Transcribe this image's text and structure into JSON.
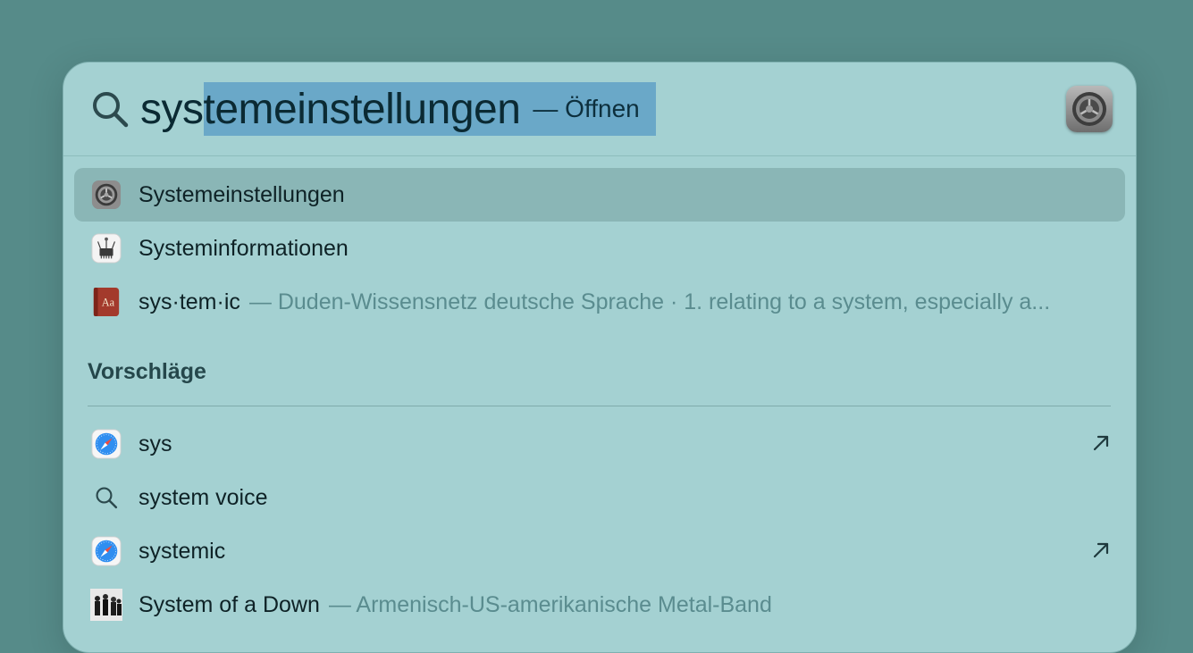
{
  "search": {
    "typed": "sys",
    "completion": "temeinstellungen",
    "action": "— Öffnen",
    "preview_icon": "system-settings-gear-icon"
  },
  "top_hits": [
    {
      "title": "Systemeinstellungen",
      "subtitle": "",
      "icon": "system-settings-icon",
      "selected": true
    },
    {
      "title": "Systeminformationen",
      "subtitle": "",
      "icon": "system-information-icon"
    },
    {
      "title": "sys·tem·ic",
      "subtitle": "— Duden-Wissensnetz deutsche Sprache · 1. relating to a system, especially a...",
      "icon": "dictionary-icon"
    }
  ],
  "suggestions": {
    "header": "Vorschläge",
    "items": [
      {
        "title": "sys",
        "icon": "safari-icon",
        "arrow": true
      },
      {
        "title": "system voice",
        "icon": "search-icon",
        "arrow": false
      },
      {
        "title": "systemic",
        "icon": "safari-icon",
        "arrow": true
      },
      {
        "title": "System of a Down",
        "subtitle": "— Armenisch-US-amerikanische Metal-Band",
        "icon": "band-photo-icon",
        "arrow": false
      }
    ]
  },
  "colors": {
    "background": "#568b89",
    "panel": "#a4d1d2",
    "selection": "#6aa8c8",
    "row_selected": "#8ab6b6"
  }
}
